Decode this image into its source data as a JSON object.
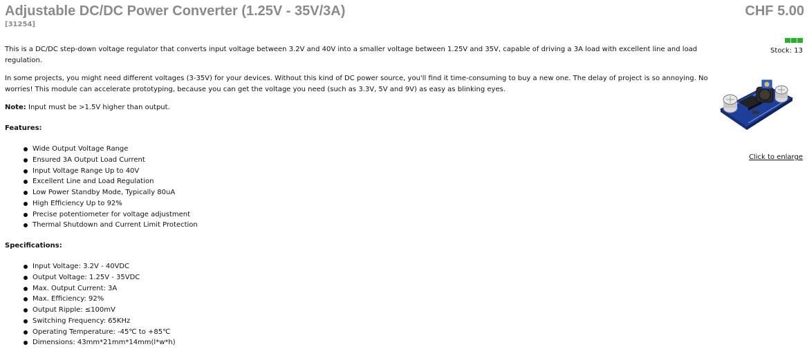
{
  "product": {
    "title": "Adjustable DC/DC Power Converter (1.25V - 35V/3A)",
    "sku": "[31254]",
    "price": "CHF 5.00",
    "stock": "Stock: 13",
    "stock_level_bars": 3,
    "stock_color": "#22b522",
    "enlarge_link": "Click to enlarge",
    "image_alt": "DC/DC step-down converter module"
  },
  "description": {
    "intro": "This is a DC/DC step-down voltage regulator that converts input voltage between 3.2V and 40V into a smaller voltage between 1.25V and 35V, capable of driving a 3A load with excellent line and load regulation.",
    "para2": "In some projects, you might need different voltages (3-35V) for your devices. Without this kind of DC power source, you'll find it time-consuming to buy a new one. The delay of project is so annoying. No worries! This module can accelerate prototyping, because you can get the voltage you need (such as 3.3V, 5V and 9V) as easy as blinking eyes.",
    "note_label": "Note:",
    "note_text": " Input must be >1.5V higher than output."
  },
  "features": {
    "heading": "Features:",
    "items": [
      "Wide Output Voltage Range",
      "Ensured 3A Output Load Current",
      "Input Voltage Range Up to 40V",
      "Excellent Line and Load Regulation",
      "Low Power Standby Mode, Typically 80uA",
      "High Efficiency Up to 92%",
      "Precise potentiometer for voltage adjustment",
      "Thermal Shutdown and Current Limit Protection"
    ]
  },
  "specifications": {
    "heading": "Specifications:",
    "items": [
      "Input Voltage: 3.2V - 40VDC",
      "Output Voltage: 1.25V - 35VDC",
      "Max. Output Current: 3A",
      "Max. Efficiency: 92%",
      "Output Ripple: ≤100mV",
      "Switching Frequency: 65KHz",
      "Operating Temperature: -45℃ to +85℃",
      "Dimensions: 43mm*21mm*14mm(l*w*h)"
    ]
  }
}
